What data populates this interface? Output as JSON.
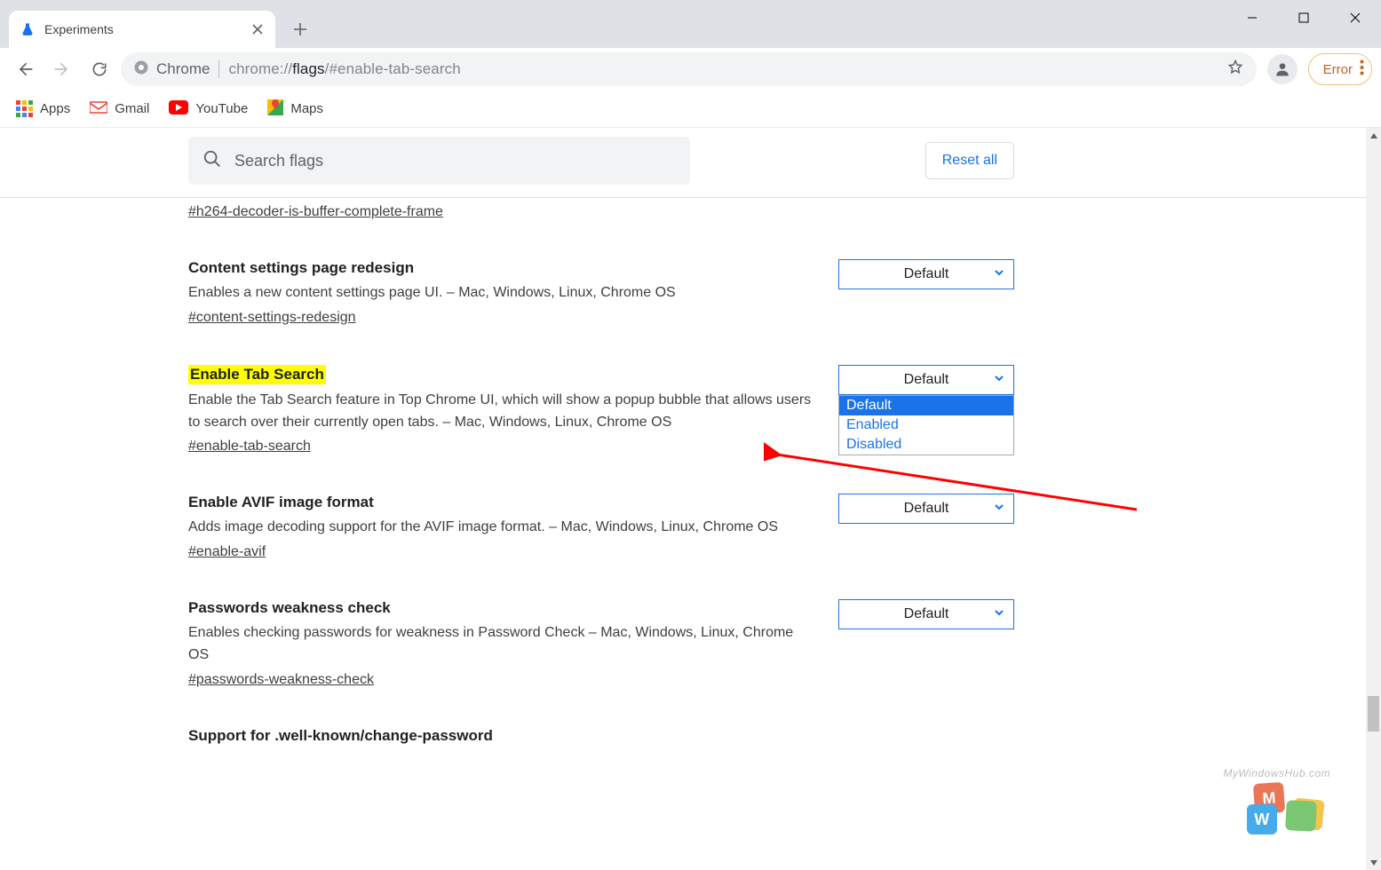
{
  "tab": {
    "title": "Experiments"
  },
  "omnibox": {
    "chip_label": "Chrome",
    "url_prefix": "chrome://",
    "url_bold": "flags",
    "url_suffix": "/#enable-tab-search"
  },
  "error_chip": {
    "label": "Error"
  },
  "bookmarks": {
    "apps": "Apps",
    "gmail": "Gmail",
    "youtube": "YouTube",
    "maps": "Maps"
  },
  "search": {
    "placeholder": "Search flags"
  },
  "reset_label": "Reset all",
  "top_anchor": "#h264-decoder-is-buffer-complete-frame",
  "flags": [
    {
      "title": "Content settings page redesign",
      "desc": "Enables a new content settings page UI. – Mac, Windows, Linux, Chrome OS",
      "anchor": "#content-settings-redesign",
      "value": "Default"
    },
    {
      "title": "Enable Tab Search",
      "desc": "Enable the Tab Search feature in Top Chrome UI, which will show a popup bubble that allows users to search over their currently open tabs. – Mac, Windows, Linux, Chrome OS",
      "anchor": "#enable-tab-search",
      "value": "Default",
      "highlight": true,
      "open": true
    },
    {
      "title": "Enable AVIF image format",
      "desc": "Adds image decoding support for the AVIF image format. – Mac, Windows, Linux, Chrome OS",
      "anchor": "#enable-avif",
      "value": "Default"
    },
    {
      "title": "Passwords weakness check",
      "desc": "Enables checking passwords for weakness in Password Check – Mac, Windows, Linux, Chrome OS",
      "anchor": "#passwords-weakness-check",
      "value": "Default"
    }
  ],
  "last_title": "Support for .well-known/change-password",
  "dropdown_options": [
    "Default",
    "Enabled",
    "Disabled"
  ],
  "watermark": "MyWindowsHub.com"
}
